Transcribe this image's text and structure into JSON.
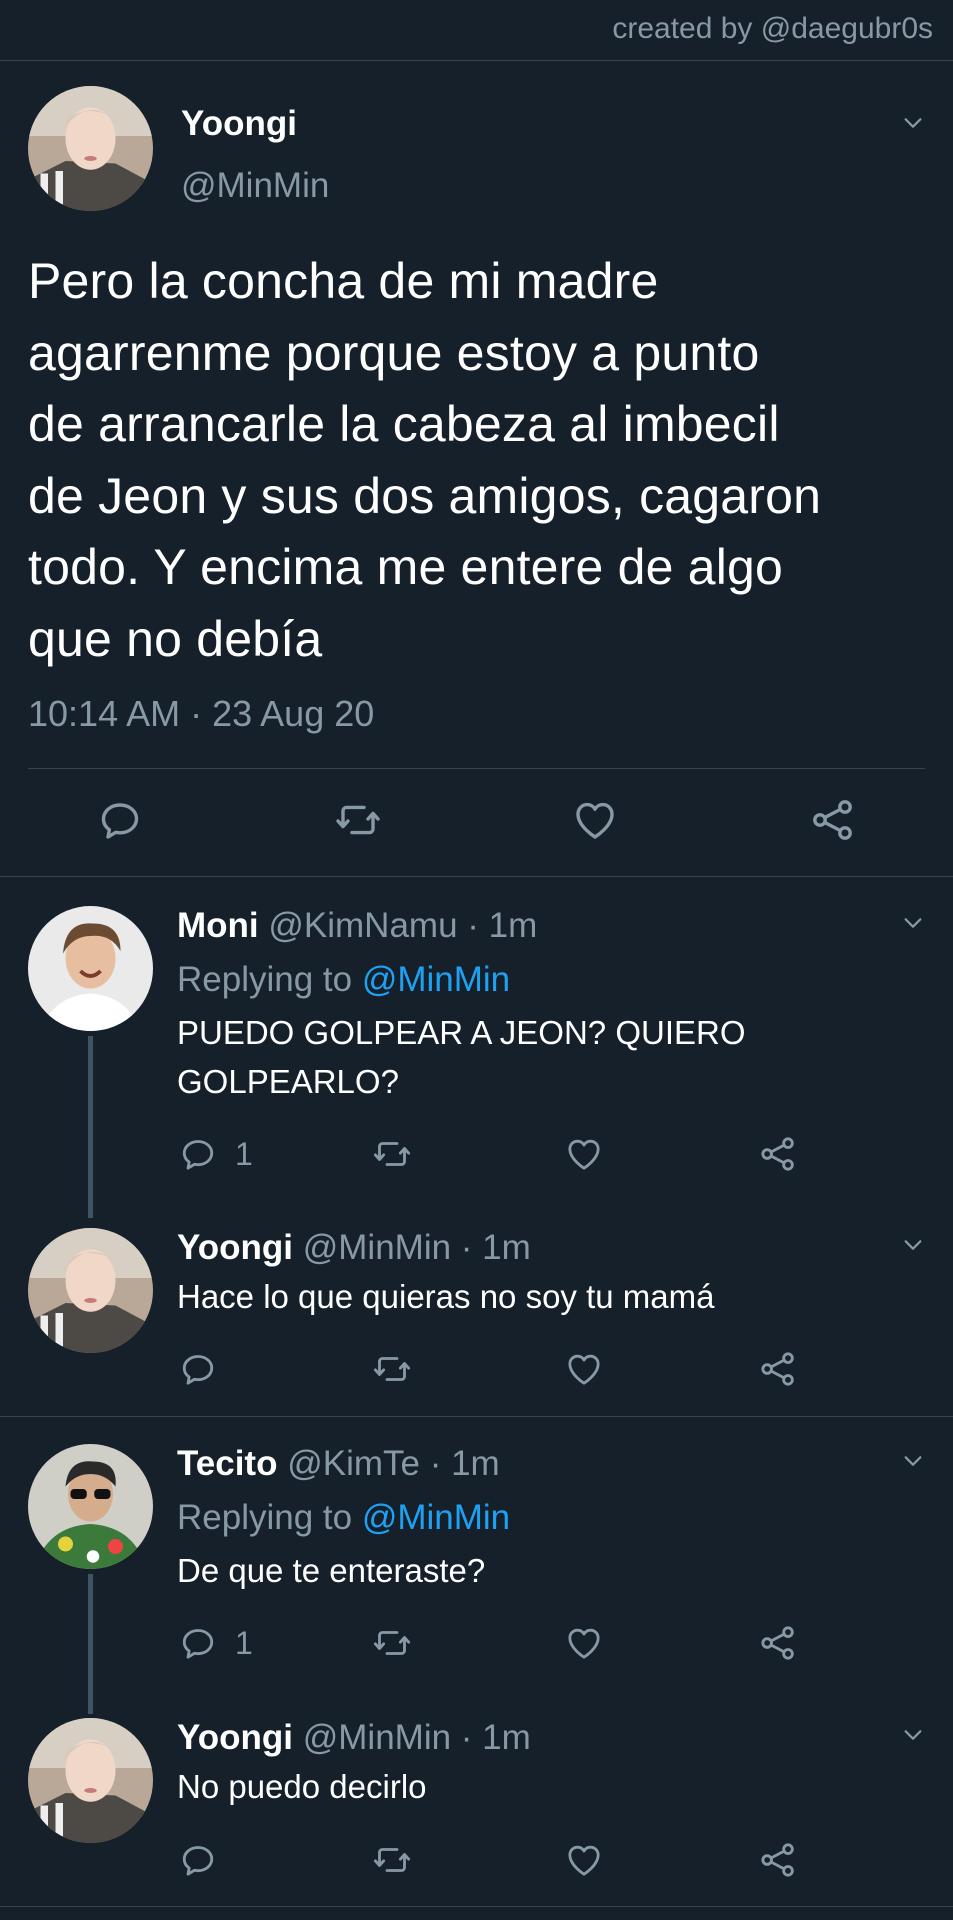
{
  "credit": "created by @daegubr0s",
  "main_tweet": {
    "name": "Yoongi",
    "handle": "@MinMin",
    "text_lines": [
      "Pero la concha de mi madre",
      "agarrenme porque estoy a punto",
      "de arrancarle la cabeza al imbecil",
      "de Jeon y sus dos amigos, cagaron",
      "todo. Y encima me entere de algo",
      "que no debía"
    ],
    "timestamp": "10:14 AM · 23 Aug 20"
  },
  "replies": [
    {
      "name": "Moni",
      "handle": "@KimNamu · 1m",
      "replying_prefix": "Replying to ",
      "replying_to": "@MinMin",
      "text_lines": [
        "PUEDO GOLPEAR A JEON? QUIERO",
        "GOLPEARLO?"
      ],
      "reply_count": "1"
    },
    {
      "name": "Yoongi",
      "handle": "@MinMin · 1m",
      "text_lines": [
        "Hace lo que quieras no soy tu mamá"
      ]
    },
    {
      "name": "Tecito",
      "handle": "@KimTe · 1m",
      "replying_prefix": "Replying to ",
      "replying_to": "@MinMin",
      "text_lines": [
        "De que te enteraste?"
      ],
      "reply_count": "1"
    },
    {
      "name": "Yoongi",
      "handle": "@MinMin · 1m",
      "text_lines": [
        "No puedo decirlo"
      ]
    }
  ],
  "icons": {
    "reply": "reply-icon",
    "retweet": "retweet-icon",
    "like": "heart-icon",
    "share": "share-icon",
    "more": "chevron-down-icon"
  },
  "colors": {
    "background": "#15202b",
    "secondary_text": "#8899a6",
    "link": "#1da1f2",
    "divider": "#38444d"
  }
}
